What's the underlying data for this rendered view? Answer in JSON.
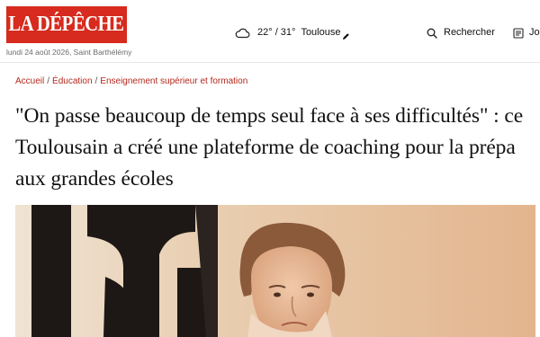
{
  "header": {
    "logo_text": "LA DÉPÊCHE",
    "date_text": "lundi 24 août 2026, Saint Barthélémy",
    "weather": {
      "icon": "cloud-icon",
      "temperature": "22° / 31°",
      "city": "Toulouse",
      "edit_icon": "pencil-icon"
    },
    "search": {
      "icon": "search-icon",
      "label": "Rechercher"
    },
    "journal": {
      "icon": "newspaper-icon",
      "label": "Jo"
    }
  },
  "breadcrumb": {
    "items": [
      "Accueil",
      "Éducation",
      "Enseignement supérieur et formation"
    ],
    "separator": "/"
  },
  "article": {
    "title": "\"On passe beaucoup de temps seul face à ses difficultés\" : ce Toulousain a créé une plateforme de coaching pour la prépa aux grandes écoles"
  },
  "colors": {
    "brand_red": "#d62b1e",
    "breadcrumb_red": "#b5281d"
  }
}
